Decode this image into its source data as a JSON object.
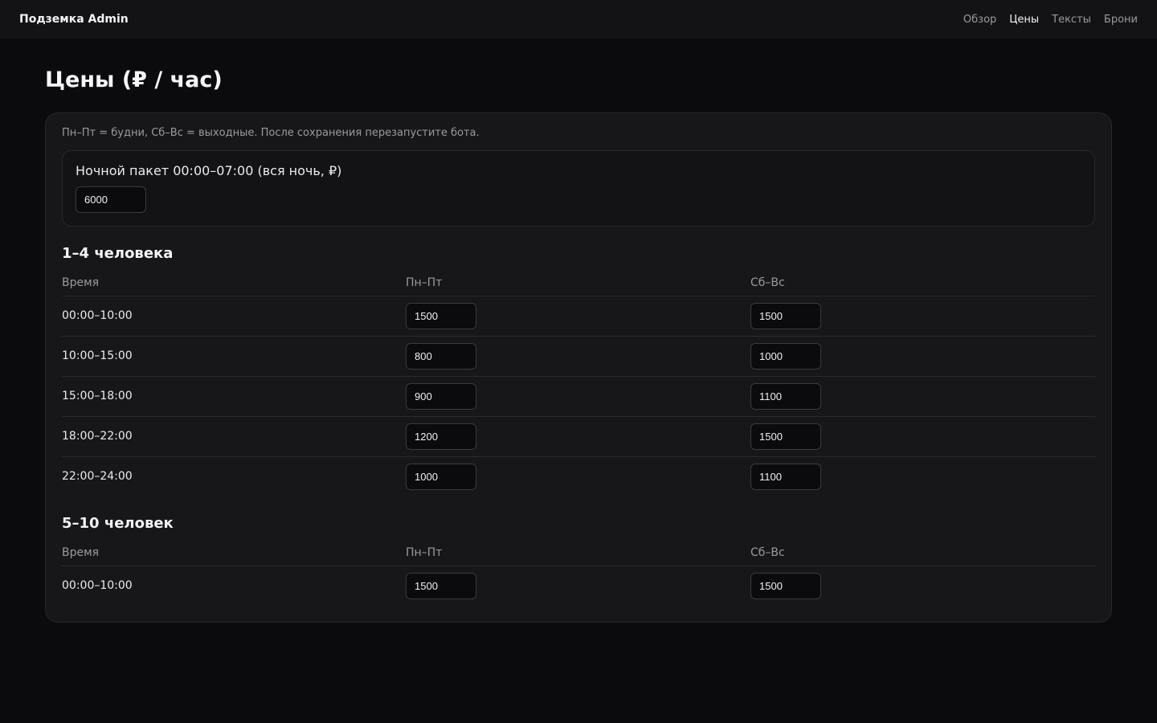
{
  "header": {
    "brand": "Подземка Admin",
    "nav": [
      "Обзор",
      "Цены",
      "Тексты",
      "Брони"
    ],
    "active": "Цены"
  },
  "page": {
    "title": "Цены (₽ / час)",
    "hint": "Пн–Пт = будни, Сб–Вс = выходные. После сохранения перезапустите бота.",
    "night_package": {
      "label": "Ночной пакет 00:00–07:00 (вся ночь, ₽)",
      "value": "6000"
    },
    "columns": {
      "time": "Время",
      "weekday": "Пн–Пт",
      "weekend": "Сб–Вс"
    },
    "groups": [
      {
        "title": "1–4 человека",
        "rows": [
          {
            "time": "00:00–10:00",
            "weekday": "1500",
            "weekend": "1500"
          },
          {
            "time": "10:00–15:00",
            "weekday": "800",
            "weekend": "1000"
          },
          {
            "time": "15:00–18:00",
            "weekday": "900",
            "weekend": "1100"
          },
          {
            "time": "18:00–22:00",
            "weekday": "1200",
            "weekend": "1500"
          },
          {
            "time": "22:00–24:00",
            "weekday": "1000",
            "weekend": "1100"
          }
        ]
      },
      {
        "title": "5–10 человек",
        "rows": [
          {
            "time": "00:00–10:00",
            "weekday": "1500",
            "weekend": "1500"
          }
        ]
      }
    ]
  }
}
